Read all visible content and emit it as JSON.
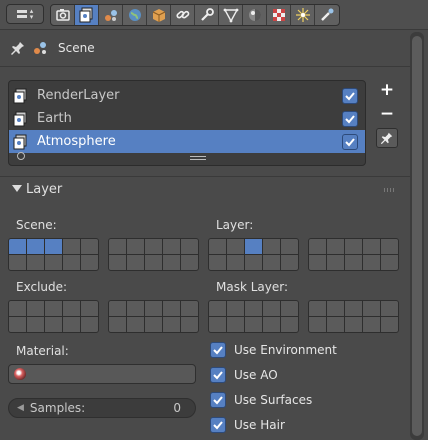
{
  "header": {
    "editor_icon": "editor-type-icon",
    "tabs": [
      {
        "name": "render-tab-icon",
        "active": false
      },
      {
        "name": "render-layers-tab-icon",
        "active": true
      },
      {
        "name": "scene-tab-icon",
        "active": false
      },
      {
        "name": "world-tab-icon",
        "active": false
      },
      {
        "name": "object-tab-icon",
        "active": false
      },
      {
        "name": "constraints-tab-icon",
        "active": false
      },
      {
        "name": "modifiers-tab-icon",
        "active": false
      },
      {
        "name": "data-tab-icon",
        "active": false
      },
      {
        "name": "material-tab-icon",
        "active": false
      },
      {
        "name": "texture-tab-icon",
        "active": false
      },
      {
        "name": "particles-tab-icon",
        "active": false
      },
      {
        "name": "physics-tab-icon",
        "active": false
      }
    ]
  },
  "context": {
    "label": "Scene"
  },
  "render_layers": {
    "items": [
      {
        "label": "RenderLayer",
        "enabled": true,
        "selected": false
      },
      {
        "label": "Earth",
        "enabled": true,
        "selected": false
      },
      {
        "label": "Atmosphere",
        "enabled": true,
        "selected": true
      }
    ],
    "add_label": "+",
    "remove_label": "−"
  },
  "layer_panel": {
    "title": "Layer",
    "scene_label": "Scene:",
    "layer_label": "Layer:",
    "exclude_label": "Exclude:",
    "mask_layer_label": "Mask Layer:",
    "material_label": "Material:",
    "samples_label": "Samples:",
    "samples_value": "0",
    "scene_layers_on": [
      0,
      1,
      2
    ],
    "layer_layers_on": [
      2
    ],
    "options": [
      {
        "label": "Use Environment",
        "checked": true
      },
      {
        "label": "Use AO",
        "checked": true
      },
      {
        "label": "Use Surfaces",
        "checked": true
      },
      {
        "label": "Use Hair",
        "checked": true
      }
    ]
  },
  "colors": {
    "accent": "#5680c2",
    "background": "#4a4a4a",
    "list_bg": "#3d3d3d"
  }
}
